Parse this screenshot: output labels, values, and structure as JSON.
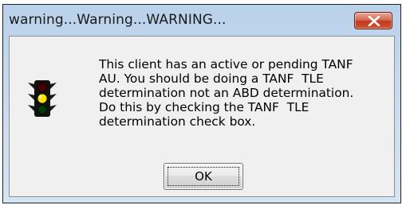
{
  "dialog": {
    "title": "warning...Warning...WARNING...",
    "message": "This client has an active or pending TANF\nAU. You should be doing a TANF  TLE\ndetermination not an ABD determination.\nDo this by checking the TANF  TLE\ndetermination check box.",
    "ok_label": "OK",
    "icon": "traffic-light-icon",
    "close_icon": "close-icon"
  },
  "colors": {
    "title_bar": "#c4d8ee",
    "client_bg": "#f0f0f0",
    "close_button": "#c7432a",
    "light_red": "#e60000",
    "light_yellow": "#ffd400",
    "light_green": "#00a000"
  }
}
